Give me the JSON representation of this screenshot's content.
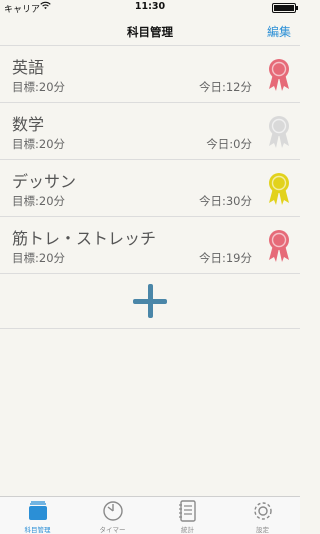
{
  "status": {
    "carrier": "キャリア",
    "time": "11:30"
  },
  "nav": {
    "title": "科目管理",
    "edit": "編集"
  },
  "subjects": [
    {
      "name": "英語",
      "goal": "目標:20分",
      "today": "今日:12分",
      "medal_color": "#e66a78"
    },
    {
      "name": "数学",
      "goal": "目標:20分",
      "today": "今日:0分",
      "medal_color": "#d9d9d9"
    },
    {
      "name": "デッサン",
      "goal": "目標:20分",
      "today": "今日:30分",
      "medal_color": "#e2d21c"
    },
    {
      "name": "筋トレ・ストレッチ",
      "goal": "目標:20分",
      "today": "今日:19分",
      "medal_color": "#e66a78"
    }
  ],
  "tabs": [
    {
      "label": "科目管理",
      "icon": "folder-icon",
      "active": true
    },
    {
      "label": "タイマー",
      "icon": "timer-icon",
      "active": false
    },
    {
      "label": "統計",
      "icon": "notebook-icon",
      "active": false
    },
    {
      "label": "設定",
      "icon": "gear-icon",
      "active": false
    }
  ],
  "colors": {
    "accent": "#2b8fd6",
    "plus": "#4a86a8",
    "background": "#f6f5f0"
  }
}
